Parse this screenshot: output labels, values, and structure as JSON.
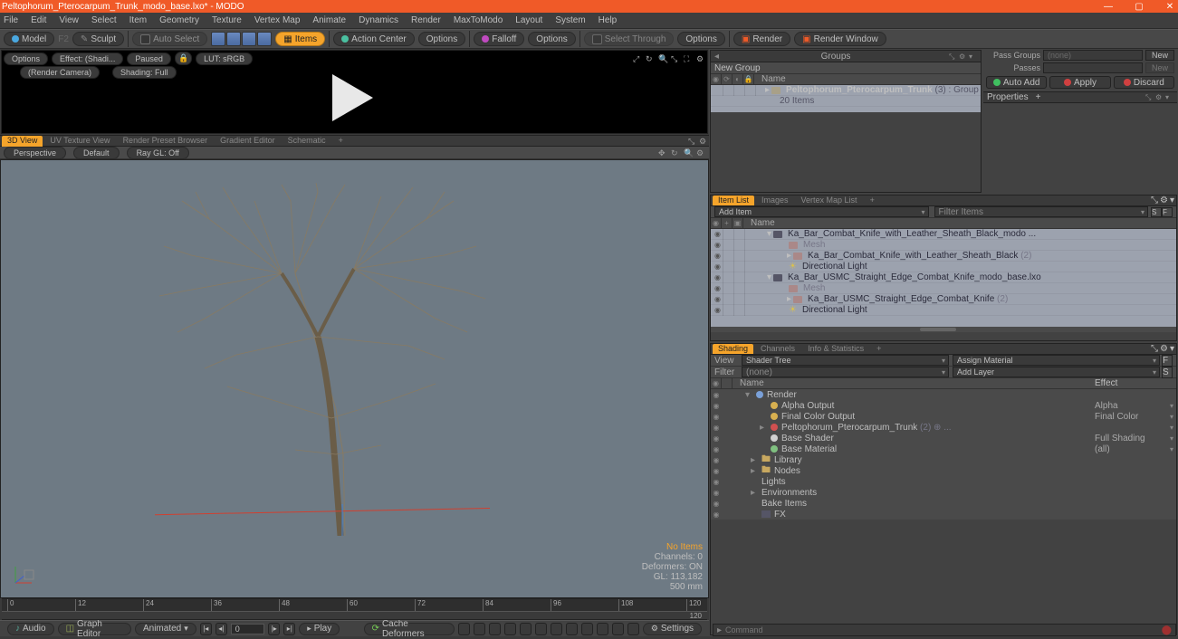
{
  "title": "Peltophorum_Pterocarpum_Trunk_modo_base.lxo* - MODO",
  "menu": [
    "File",
    "Edit",
    "View",
    "Select",
    "Item",
    "Geometry",
    "Texture",
    "Vertex Map",
    "Animate",
    "Dynamics",
    "Render",
    "MaxToModo",
    "Layout",
    "System",
    "Help"
  ],
  "toolbar": {
    "model": "Model",
    "sculpt": "Sculpt",
    "autoselect": "Auto Select",
    "items": "Items",
    "actioncenter": "Action Center",
    "options": "Options",
    "falloff": "Falloff",
    "selectthrough": "Select Through",
    "render": "Render",
    "renderwindow": "Render Window"
  },
  "preview": {
    "options": "Options",
    "effect": "Effect: (Shadi...",
    "paused": "Paused",
    "lut": "LUT: sRGB",
    "rendercam": "(Render Camera)",
    "shading": "Shading: Full"
  },
  "viewtabs": [
    "3D View",
    "UV Texture View",
    "Render Preset Browser",
    "Gradient Editor",
    "Schematic"
  ],
  "vpbar": {
    "persp": "Perspective",
    "default": "Default",
    "raygl": "Ray GL: Off"
  },
  "status": {
    "noitems": "No Items",
    "channels": "Channels: 0",
    "deformers": "Deformers: ON",
    "gl": "GL: 113,182",
    "scale": "500 mm"
  },
  "timeline": {
    "ticks": [
      "0",
      "12",
      "24",
      "36",
      "48",
      "60",
      "72",
      "84",
      "96",
      "108",
      "120"
    ],
    "end": "120"
  },
  "transport": {
    "audio": "Audio",
    "graph": "Graph Editor",
    "animated": "Animated",
    "frame": "0",
    "play": "Play",
    "cache": "Cache Deformers",
    "settings": "Settings"
  },
  "groups": {
    "title": "Groups",
    "newgroup": "New Group",
    "namecol": "Name",
    "item": "Peltophorum_Pterocarpum_Trunk",
    "suffix": "(3) : Group",
    "sub": "20 Items"
  },
  "passes": {
    "passgroups_l": "Pass Groups",
    "passes_l": "Passes",
    "none": "(none)",
    "new": "New"
  },
  "actions": {
    "auto": "Auto Add",
    "apply": "Apply",
    "discard": "Discard"
  },
  "properties": "Properties",
  "itemlist": {
    "tabs": [
      "Item List",
      "Images",
      "Vertex Map List"
    ],
    "additem": "Add Item",
    "filter": "Filter Items",
    "namecol": "Name",
    "rows": [
      {
        "t": "Ka_Bar_Combat_Knife_with_Leather_Sheath_Black_modo ...",
        "ind": 24,
        "scene": true,
        "exp": "▾"
      },
      {
        "t": "Mesh",
        "ind": 46,
        "dim": true
      },
      {
        "t": "Ka_Bar_Combat_Knife_with_Leather_Sheath_Black",
        "suf": "(2)",
        "ind": 46,
        "arrow": "▸"
      },
      {
        "t": "Directional Light",
        "ind": 46,
        "light": true
      },
      {
        "t": "Ka_Bar_USMC_Straight_Edge_Combat_Knife_modo_base.lxo",
        "ind": 24,
        "scene": true,
        "exp": "▾"
      },
      {
        "t": "Mesh",
        "ind": 46,
        "dim": true
      },
      {
        "t": "Ka_Bar_USMC_Straight_Edge_Combat_Knife",
        "suf": "(2)",
        "ind": 46,
        "arrow": "▸"
      },
      {
        "t": "Directional Light",
        "ind": 46,
        "light": true
      }
    ]
  },
  "shading": {
    "tabs": [
      "Shading",
      "Channels",
      "Info & Statistics"
    ],
    "view_l": "View",
    "view_v": "Shader Tree",
    "assign": "Assign Material",
    "filter_l": "Filter",
    "filter_v": "(none)",
    "addlayer": "Add Layer",
    "namecol": "Name",
    "effectcol": "Effect",
    "rows": [
      {
        "n": "Render",
        "ind": 14,
        "exp": "▾",
        "ball": "#7aa0d8"
      },
      {
        "n": "Alpha Output",
        "eff": "Alpha",
        "ind": 30,
        "ball": "#d8b050",
        "dd": true
      },
      {
        "n": "Final Color Output",
        "eff": "Final Color",
        "ind": 30,
        "ball": "#d8b050",
        "dd": true
      },
      {
        "n": "Peltophorum_Pterocarpum_Trunk",
        "suf": "(2) ⊕ ...",
        "ind": 30,
        "ball": "#d05050",
        "arrow": "▸",
        "dd": true
      },
      {
        "n": "Base Shader",
        "eff": "Full Shading",
        "ind": 30,
        "ball": "#d0d0d0",
        "dd": true
      },
      {
        "n": "Base Material",
        "eff": "(all)",
        "ind": 30,
        "ball": "#80c080",
        "dd": true
      },
      {
        "n": "Library",
        "ind": 20,
        "arrow": "▸",
        "folder": true
      },
      {
        "n": "Nodes",
        "ind": 20,
        "arrow": "▸",
        "folder": true
      },
      {
        "n": "Lights",
        "ind": 20
      },
      {
        "n": "Environments",
        "ind": 20,
        "arrow": "▸"
      },
      {
        "n": "Bake Items",
        "ind": 20
      },
      {
        "n": "FX",
        "ind": 20,
        "scene": true
      }
    ]
  },
  "command_ph": "Command"
}
